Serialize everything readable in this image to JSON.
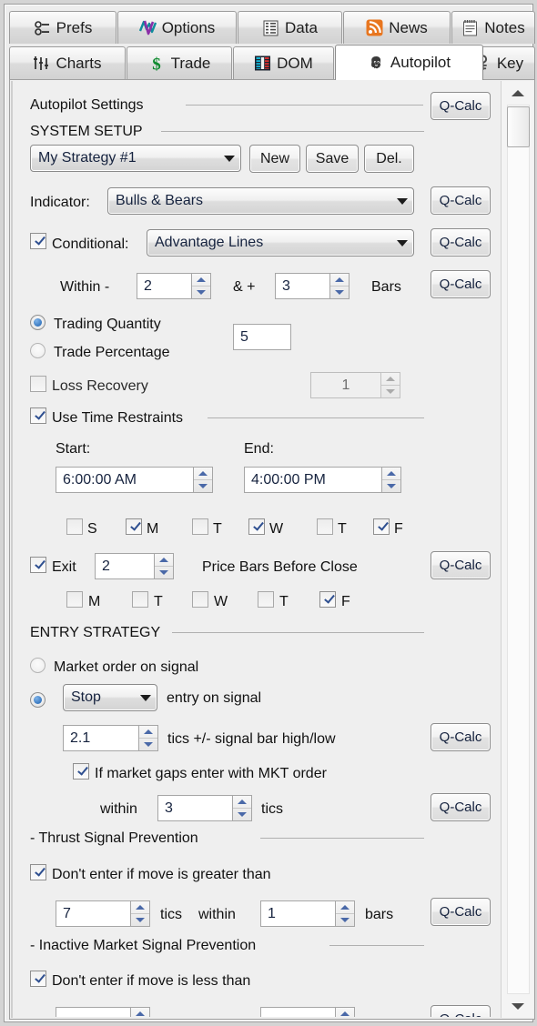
{
  "window": {
    "title": "Autopilot"
  },
  "tabs": {
    "row1": [
      {
        "label": "Prefs",
        "icon": "prefs-sliders-icon",
        "active": false
      },
      {
        "label": "Options",
        "icon": "options-zigzag-icon",
        "active": false
      },
      {
        "label": "Data",
        "icon": "data-grid-icon",
        "active": false
      },
      {
        "label": "News",
        "icon": "news-rss-icon",
        "active": false
      },
      {
        "label": "Notes",
        "icon": "notes-pad-icon",
        "active": false
      }
    ],
    "row2": [
      {
        "label": "Charts",
        "icon": "charts-bars-icon",
        "active": false
      },
      {
        "label": "Trade",
        "icon": "trade-dollar-icon",
        "active": false
      },
      {
        "label": "DOM",
        "icon": "dom-ladder-icon",
        "active": false
      },
      {
        "label": "Autopilot",
        "icon": "autopilot-face-icon",
        "active": true
      },
      {
        "label": "Key",
        "icon": "key-icon",
        "active": false
      }
    ]
  },
  "panel": {
    "title": "Autopilot Settings",
    "qcalc_label": "Q-Calc",
    "sections": {
      "system_setup": {
        "header": "SYSTEM SETUP",
        "strategy_select": {
          "value": "My Strategy #1"
        },
        "new_button": "New",
        "save_button": "Save",
        "delete_button": "Del.",
        "indicator_label": "Indicator:",
        "indicator_select": {
          "value": "Bulls & Bears"
        },
        "conditional_label": "Conditional:",
        "conditional_checked": true,
        "conditional_select": {
          "value": "Advantage Lines"
        },
        "within_label": "Within -",
        "within_minus_value": "2",
        "amp_plus_label": "& +",
        "within_plus_value": "3",
        "bars_label": "Bars",
        "trading_quantity_label": "Trading Quantity",
        "trading_quantity_selected": true,
        "trade_percentage_label": "Trade Percentage",
        "trade_percentage_selected": false,
        "quantity_value": "5",
        "loss_recovery_label": "Loss Recovery",
        "loss_recovery_checked": false,
        "loss_recovery_value": "1",
        "time_restraints_label": "Use Time Restraints",
        "time_restraints_checked": true,
        "start_label": "Start:",
        "start_value": "6:00:00 AM",
        "end_label": "End:",
        "end_value": "4:00:00 PM",
        "days": [
          {
            "label": "S",
            "checked": false
          },
          {
            "label": "M",
            "checked": true
          },
          {
            "label": "T",
            "checked": false
          },
          {
            "label": "W",
            "checked": true
          },
          {
            "label": "T",
            "checked": false
          },
          {
            "label": "F",
            "checked": true
          }
        ],
        "exit_label": "Exit",
        "exit_checked": true,
        "exit_value": "2",
        "exit_suffix": "Price Bars Before Close",
        "exit_days": [
          {
            "label": "M",
            "checked": false
          },
          {
            "label": "T",
            "checked": false
          },
          {
            "label": "W",
            "checked": false
          },
          {
            "label": "T",
            "checked": false
          },
          {
            "label": "F",
            "checked": true
          }
        ]
      },
      "entry_strategy": {
        "header": "ENTRY STRATEGY",
        "market_order_label": "Market order on signal",
        "market_order_selected": false,
        "order_type_selected": true,
        "order_type_select": {
          "value": "Stop"
        },
        "order_type_suffix": "entry on signal",
        "tics_value": "2.1",
        "tics_suffix": "tics +/- signal bar high/low",
        "gap_checkbox_label": "If market gaps enter with MKT order",
        "gap_checked": true,
        "within_label": "within",
        "within_value": "3",
        "within_suffix": "tics"
      },
      "thrust": {
        "header": "- Thrust Signal Prevention",
        "rule_label": "Don't enter if move is greater than",
        "rule_checked": true,
        "tics_value": "7",
        "tics_label": "tics",
        "within_label": "within",
        "bars_value": "1",
        "bars_label": "bars"
      },
      "inactive": {
        "header": "- Inactive Market Signal Prevention",
        "rule_label": "Don't enter if move is less than",
        "rule_checked": true
      }
    }
  },
  "colors": {
    "accent_blue": "#1b5fae",
    "text": "#111111",
    "field_text": "#16233f",
    "panel_bg": "#efefef",
    "rss_orange": "#e8761f",
    "trade_green": "#0f8a2f",
    "options_purple": "#8b2fa8",
    "options_teal": "#0f8c9c"
  }
}
